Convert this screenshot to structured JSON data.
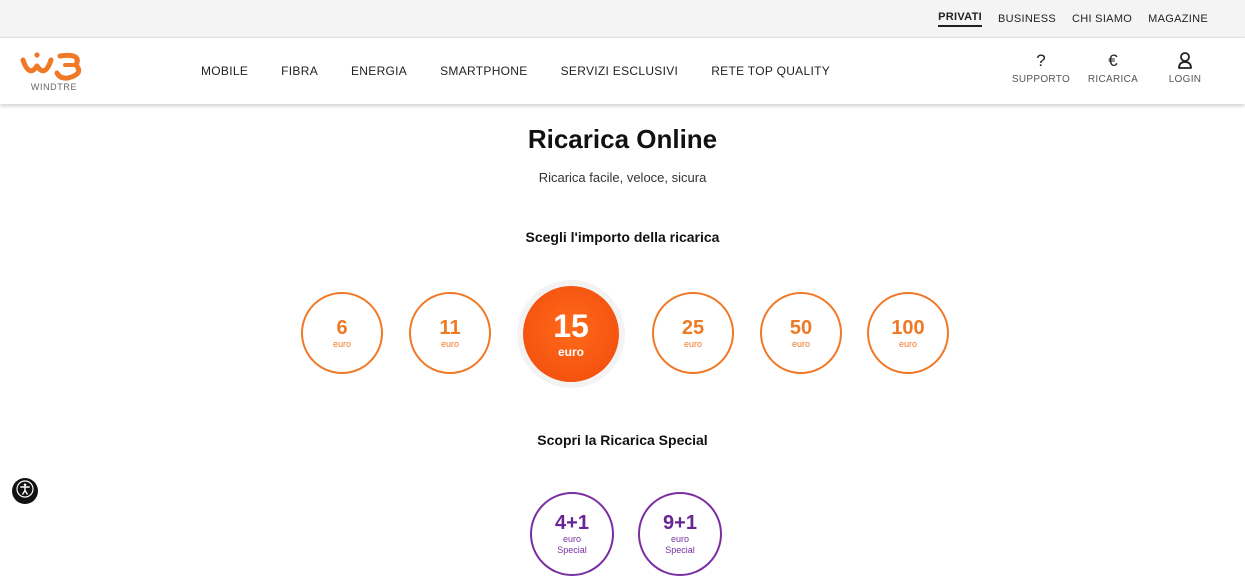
{
  "topbar": {
    "links": [
      {
        "label": "PRIVATI",
        "active": true
      },
      {
        "label": "BUSINESS",
        "active": false
      },
      {
        "label": "CHI SIAMO",
        "active": false
      },
      {
        "label": "MAGAZINE",
        "active": false
      }
    ]
  },
  "header": {
    "logo_text": "WINDTRE",
    "brand_colors": {
      "orange": "#f07826",
      "purple": "#7a2ea3"
    },
    "nav": [
      "MOBILE",
      "FIBRA",
      "ENERGIA",
      "SMARTPHONE",
      "SERVIZI ESCLUSIVI",
      "RETE TOP QUALITY"
    ],
    "actions": [
      {
        "icon": "question-icon",
        "glyph": "?",
        "label": "SUPPORTO"
      },
      {
        "icon": "euro-icon",
        "glyph": "€",
        "label": "RICARICA"
      },
      {
        "icon": "user-login-icon",
        "glyph": "",
        "label": "LOGIN"
      }
    ]
  },
  "main": {
    "title": "Ricarica Online",
    "subtitle": "Ricarica facile, veloce, sicura",
    "amount_section_title": "Scegli l'importo della ricarica",
    "amounts": [
      {
        "value": "6",
        "unit": "euro",
        "selected": false
      },
      {
        "value": "11",
        "unit": "euro",
        "selected": false
      },
      {
        "value": "15",
        "unit": "euro",
        "selected": true
      },
      {
        "value": "25",
        "unit": "euro",
        "selected": false
      },
      {
        "value": "50",
        "unit": "euro",
        "selected": false
      },
      {
        "value": "100",
        "unit": "euro",
        "selected": false
      }
    ],
    "special_section_title": "Scopri la Ricarica Special",
    "specials": [
      {
        "value": "4+1",
        "unit": "euro",
        "tag": "Special"
      },
      {
        "value": "9+1",
        "unit": "euro",
        "tag": "Special"
      }
    ]
  },
  "accessibility": {
    "icon": "accessibility-icon"
  }
}
